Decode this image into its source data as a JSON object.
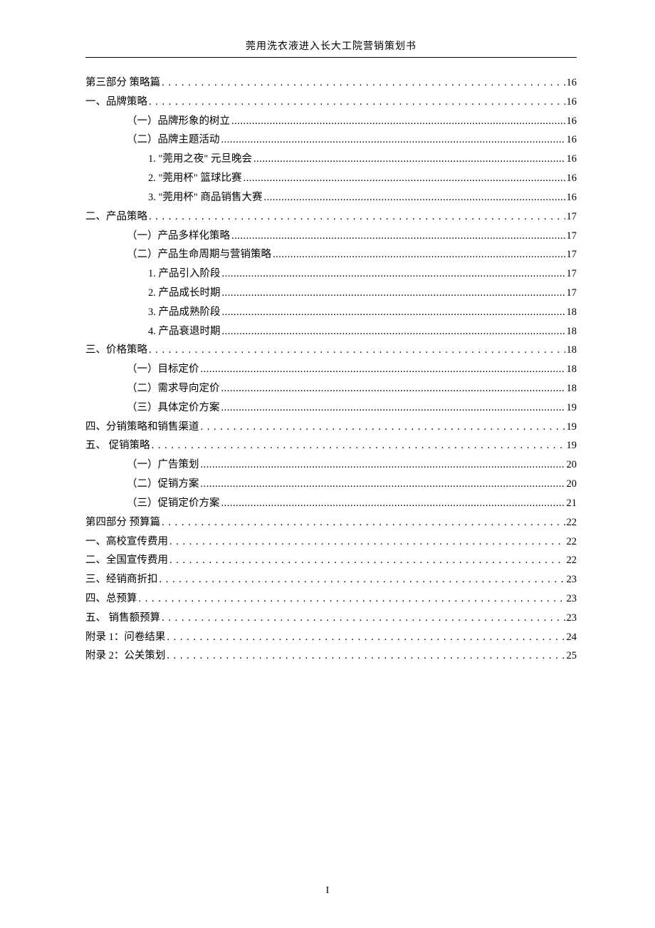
{
  "header": {
    "title": "莞用洗衣液进入长大工院营销策划书"
  },
  "footer": {
    "page_number": "I"
  },
  "toc": [
    {
      "label": "第三部分  策略篇",
      "page": "16",
      "indent": 0,
      "leader": "spaced"
    },
    {
      "label": "一、品牌策略",
      "page": "16",
      "indent": 0,
      "leader": "spaced"
    },
    {
      "label": "（一）品牌形象的树立",
      "page": "16",
      "indent": 1,
      "leader": "dense"
    },
    {
      "label": "（二）品牌主题活动",
      "page": "16",
      "indent": 1,
      "leader": "dense"
    },
    {
      "label": "1. \"莞用之夜\" 元旦晚会",
      "page": "16",
      "indent": 2,
      "leader": "dense"
    },
    {
      "label": "2. \"莞用杯\" 篮球比赛",
      "page": "16",
      "indent": 2,
      "leader": "dense"
    },
    {
      "label": "3. \"莞用杯\" 商品销售大赛",
      "page": "16",
      "indent": 2,
      "leader": "dense"
    },
    {
      "label": "二、产品策略",
      "page": "17",
      "indent": 0,
      "leader": "spaced"
    },
    {
      "label": "（一）产品多样化策略",
      "page": "17",
      "indent": 1,
      "leader": "dense"
    },
    {
      "label": "（二）产品生命周期与营销策略",
      "page": "17",
      "indent": 1,
      "leader": "dense"
    },
    {
      "label": "1. 产品引入阶段",
      "page": "17",
      "indent": 2,
      "leader": "dense"
    },
    {
      "label": "2. 产品成长时期",
      "page": "17",
      "indent": 2,
      "leader": "dense"
    },
    {
      "label": "3. 产品成熟阶段",
      "page": "18",
      "indent": 2,
      "leader": "dense"
    },
    {
      "label": "4. 产品衰退时期",
      "page": "18",
      "indent": 2,
      "leader": "dense"
    },
    {
      "label": "三、价格策略",
      "page": "18",
      "indent": 0,
      "leader": "spaced"
    },
    {
      "label": "（一）目标定价",
      "page": "18",
      "indent": 1,
      "leader": "dense"
    },
    {
      "label": "（二）需求导向定价",
      "page": "18",
      "indent": 1,
      "leader": "dense"
    },
    {
      "label": "（三）具体定价方案",
      "page": "19",
      "indent": 1,
      "leader": "dense"
    },
    {
      "label": "四、分销策略和销售渠道",
      "page": "19",
      "indent": 0,
      "leader": "spaced"
    },
    {
      "label": "五、 促销策略",
      "page": "19",
      "indent": 0,
      "leader": "spaced"
    },
    {
      "label": "（一）广告策划",
      "page": "20",
      "indent": 1,
      "leader": "dense"
    },
    {
      "label": "（二）促销方案",
      "page": "20",
      "indent": 1,
      "leader": "dense"
    },
    {
      "label": "（三）促销定价方案",
      "page": "21",
      "indent": 1,
      "leader": "dense"
    },
    {
      "label": "第四部分    预算篇",
      "page": "22",
      "indent": 0,
      "leader": "spaced"
    },
    {
      "label": "一、高校宣传费用",
      "page": "22",
      "indent": 0,
      "leader": "spaced"
    },
    {
      "label": "二、全国宣传费用",
      "page": "22",
      "indent": 0,
      "leader": "spaced"
    },
    {
      "label": "三、经销商折扣",
      "page": "23",
      "indent": 0,
      "leader": "spaced"
    },
    {
      "label": "四、总预算",
      "page": "23",
      "indent": 0,
      "leader": "spaced"
    },
    {
      "label": "五、 销售额预算",
      "page": "23",
      "indent": 0,
      "leader": "spaced"
    },
    {
      "label": "附录 1：问卷结果",
      "page": "24",
      "indent": 0,
      "leader": "spaced"
    },
    {
      "label": "附录 2：公关策划",
      "page": "25",
      "indent": 0,
      "leader": "spaced"
    }
  ]
}
